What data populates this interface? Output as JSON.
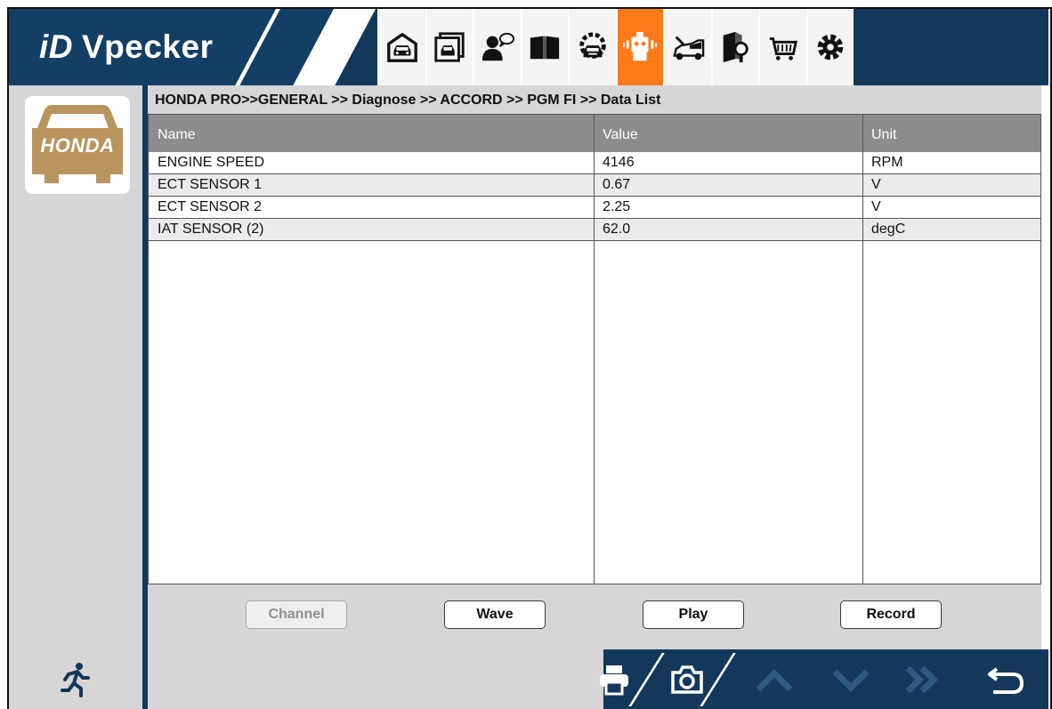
{
  "app": {
    "brand_name": "Vpecker",
    "brand_mark": "iD"
  },
  "nav": {
    "items": [
      {
        "name": "garage",
        "icon": "garage-icon"
      },
      {
        "name": "vehicle-info",
        "icon": "vehicle-window-icon"
      },
      {
        "name": "feedback",
        "icon": "user-chat-icon"
      },
      {
        "name": "manual",
        "icon": "book-icon"
      },
      {
        "name": "special-function",
        "icon": "gear-car-icon"
      },
      {
        "name": "diagnose",
        "icon": "robot-diagnose-icon",
        "active": true
      },
      {
        "name": "repair",
        "icon": "car-repair-icon"
      },
      {
        "name": "guide",
        "icon": "book-search-icon"
      },
      {
        "name": "shop",
        "icon": "cart-icon"
      },
      {
        "name": "settings",
        "icon": "gear-icon"
      }
    ],
    "active_color": "#ff7a1a"
  },
  "sidebar": {
    "brand_label": "HONDA",
    "brand_color": "#b8955c"
  },
  "breadcrumb": "HONDA PRO>>GENERAL >> Diagnose >> ACCORD >> PGM FI >> Data List",
  "table": {
    "headers": {
      "name": "Name",
      "value": "Value",
      "unit": "Unit"
    },
    "rows": [
      {
        "name": "ENGINE SPEED",
        "value": "4146",
        "unit": "RPM"
      },
      {
        "name": "ECT SENSOR 1",
        "value": "0.67",
        "unit": "V"
      },
      {
        "name": "ECT SENSOR 2",
        "value": "2.25",
        "unit": "V"
      },
      {
        "name": "IAT SENSOR (2)",
        "value": "62.0",
        "unit": "degC"
      }
    ]
  },
  "actions": {
    "channel": "Channel",
    "wave": "Wave",
    "play": "Play",
    "record": "Record"
  },
  "footer": {
    "icons": [
      "exit-running-icon",
      "print-icon",
      "screenshot-icon",
      "up-arrow-icon",
      "down-arrow-icon",
      "fast-forward-icon",
      "back-icon"
    ]
  },
  "colors": {
    "header_bg": "#14385a",
    "panel_bg": "#d6d6d6",
    "table_header_bg": "#8c8c8c"
  }
}
